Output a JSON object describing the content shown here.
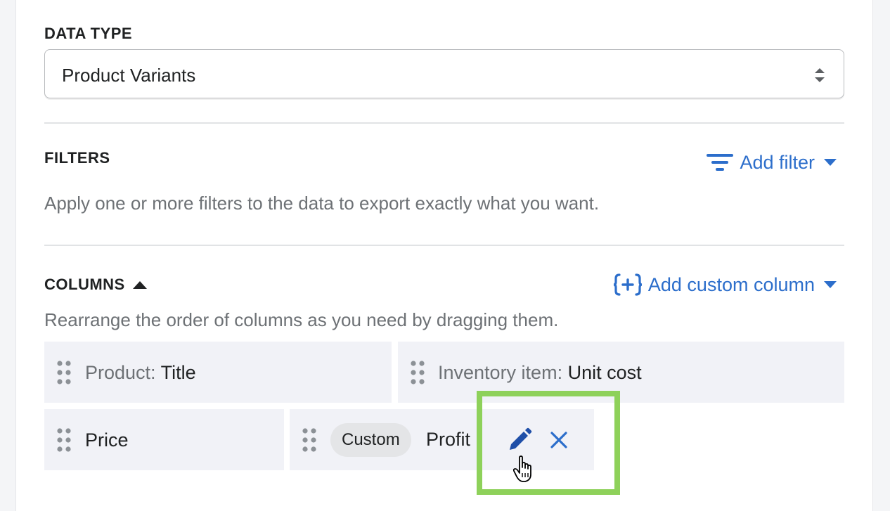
{
  "data_type": {
    "title": "DATA TYPE",
    "selected_value": "Product Variants"
  },
  "filters": {
    "title": "FILTERS",
    "add_filter_label": "Add filter",
    "help_text": "Apply one or more filters to the data to export exactly what you want."
  },
  "columns": {
    "title": "COLUMNS",
    "add_custom_column_label": "Add custom column",
    "help_text": "Rearrange the order of columns as you need by dragging them.",
    "items": [
      {
        "prefix": "Product: ",
        "name": "Title"
      },
      {
        "prefix": "Inventory item: ",
        "name": "Unit cost"
      },
      {
        "prefix": "",
        "name": "Price"
      },
      {
        "badge": "Custom",
        "name": "Profit"
      }
    ]
  },
  "colors": {
    "accent": "#2c6ecb",
    "highlight": "#8ed15a",
    "column_bg": "#f1f2f7",
    "edit_icon": "#1f4fa8"
  },
  "icons": [
    "select-arrows-icon",
    "filter-icon",
    "caret-down-icon",
    "caret-up-icon",
    "custom-column-icon",
    "drag-handle-icon",
    "pencil-icon",
    "close-icon",
    "hand-cursor-icon"
  ]
}
